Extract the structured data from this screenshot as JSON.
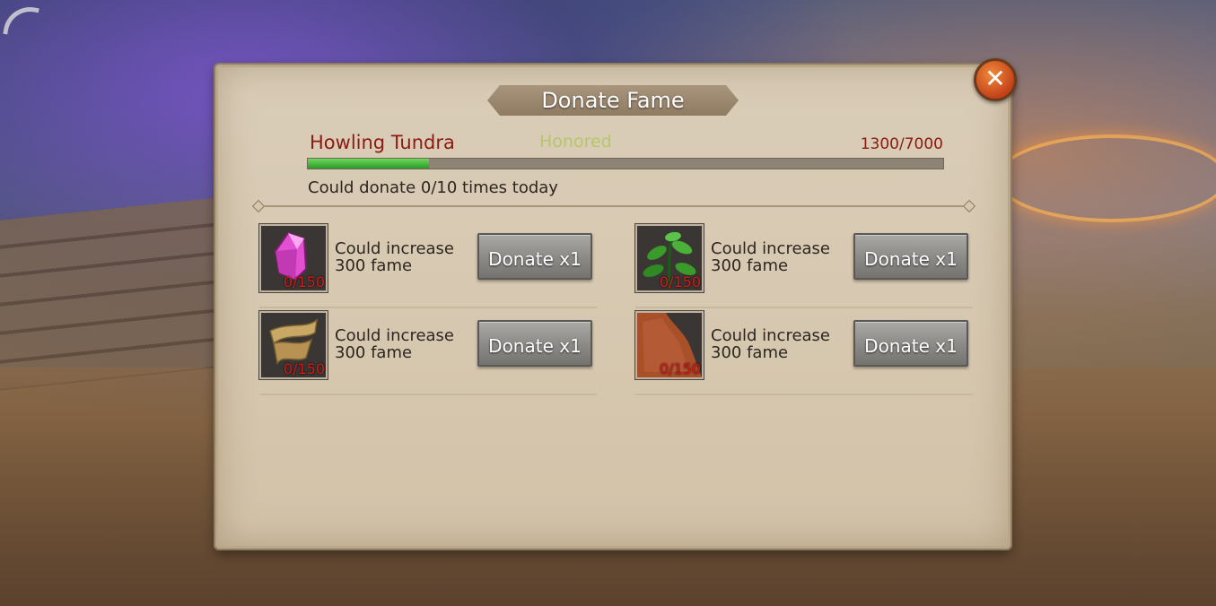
{
  "hud": {
    "signal_icon": "signal-icon"
  },
  "dialog": {
    "title": "Donate Fame",
    "close_icon": "close-icon",
    "faction": "Howling Tundra",
    "rank": "Honored",
    "fame": "1300/7000",
    "fame_progress": 0.19,
    "donate_limit": "Could donate 0/10 times today",
    "items": [
      {
        "icon": "gem-icon",
        "count": "0/150",
        "desc_line1": "Could increase",
        "desc_line2": "300 fame",
        "button": "Donate x1"
      },
      {
        "icon": "herb-icon",
        "count": "0/150",
        "desc_line1": "Could increase",
        "desc_line2": "300 fame",
        "button": "Donate x1"
      },
      {
        "icon": "scroll-icon",
        "count": "0/150",
        "desc_line1": "Could increase",
        "desc_line2": "300 fame",
        "button": "Donate x1"
      },
      {
        "icon": "leather-icon",
        "count": "0/150",
        "desc_line1": "Could increase",
        "desc_line2": "300 fame",
        "button": "Donate x1"
      }
    ]
  },
  "colors": {
    "faction_text": "#8a1a12",
    "rank_text": "#b6c76a",
    "progress_fill": "#3fb83a",
    "item_count_text": "#d21a1a"
  }
}
